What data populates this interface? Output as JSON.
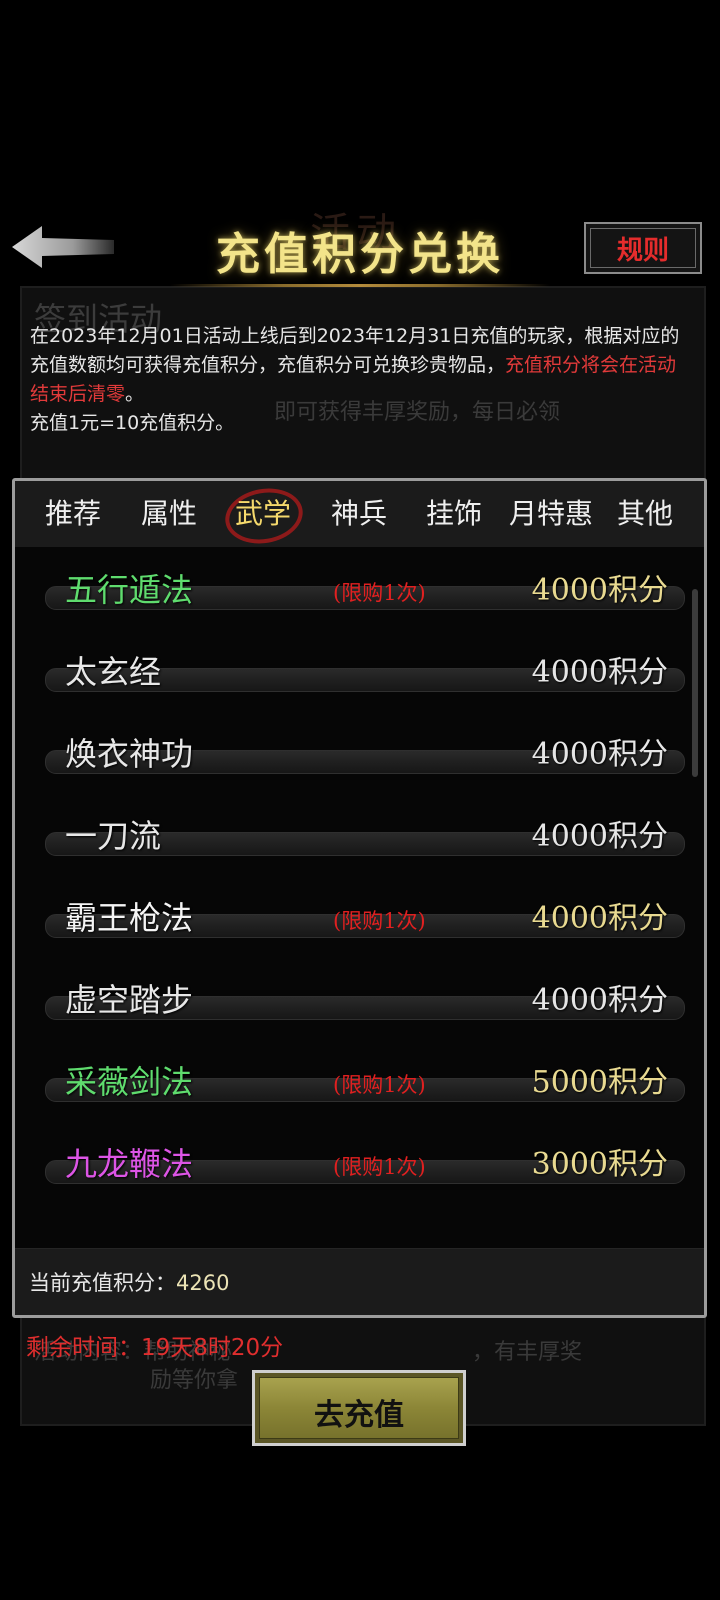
{
  "header": {
    "title": "充值积分兑换",
    "title_ghost": "活动",
    "rules_label": "规则"
  },
  "background": {
    "panel_title": "签到活动",
    "line_reward": "即可获得丰厚奖励，每日必领",
    "line_content_label": "活动内容：帮助神秘",
    "line_content_rest": "，有丰厚奖",
    "line_content_2": "励等你拿"
  },
  "description": {
    "line1": "在2023年12月01日活动上线后到2023年12月31日充值的玩家，根据对应的充值数额均可获得充值积分，充值积分可兑换珍贵物品，",
    "highlight": "充值积分将会在活动结束后清零",
    "line1_end": "。",
    "line2": "充值1元=10充值积分。"
  },
  "tabs": [
    {
      "label": "推荐"
    },
    {
      "label": "属性"
    },
    {
      "label": "武学"
    },
    {
      "label": "神兵"
    },
    {
      "label": "挂饰"
    },
    {
      "label": "月特惠"
    },
    {
      "label": "其他"
    }
  ],
  "active_tab": "武学",
  "items": [
    {
      "name": "五行遁法",
      "limit": "(限购1次)",
      "price": "4000积分",
      "name_color": "#5fdc6e",
      "price_color": "#e9da91"
    },
    {
      "name": "太玄经",
      "limit": "",
      "price": "4000积分",
      "name_color": "#e8e8e8",
      "price_color": "#e6e6e6"
    },
    {
      "name": "焕衣神功",
      "limit": "",
      "price": "4000积分",
      "name_color": "#e8e8e8",
      "price_color": "#e6e6e6"
    },
    {
      "name": "一刀流",
      "limit": "",
      "price": "4000积分",
      "name_color": "#e8e8e8",
      "price_color": "#e6e6e6"
    },
    {
      "name": "霸王枪法",
      "limit": "(限购1次)",
      "price": "4000积分",
      "name_color": "#f4f4f4",
      "price_color": "#e9da91"
    },
    {
      "name": "虚空踏步",
      "limit": "",
      "price": "4000积分",
      "name_color": "#e8e8e8",
      "price_color": "#e6e6e6"
    },
    {
      "name": "采薇剑法",
      "limit": "(限购1次)",
      "price": "5000积分",
      "name_color": "#5fdc6e",
      "price_color": "#e9da91"
    },
    {
      "name": "九龙鞭法",
      "limit": "(限购1次)",
      "price": "3000积分",
      "name_color": "#dd55e6",
      "price_color": "#e9da91"
    }
  ],
  "footer": {
    "points_label": "当前充值积分：",
    "points_value": "4260"
  },
  "remaining_time": "剩余时间：19天8时20分",
  "charge_button": "去充值"
}
